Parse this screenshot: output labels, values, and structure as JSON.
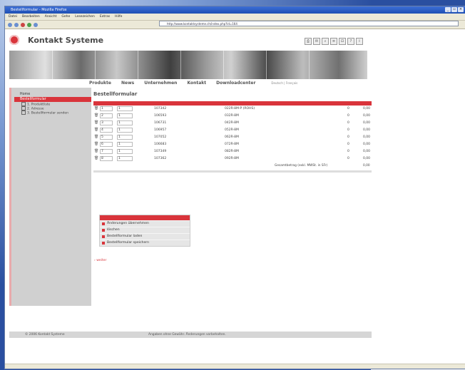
{
  "browser": {
    "title": "Bestellformular - Mozilla Firefox",
    "window_controls": [
      "_",
      "▫",
      "×"
    ],
    "menu": [
      "Datei",
      "Bearbeiten",
      "Ansicht",
      "Gehe",
      "Lesezeichen",
      "Extras",
      "Hilfe"
    ],
    "address": "http://www.kontaktsysteme.ch/index.php?id=164"
  },
  "site": {
    "logo_text": "Kontakt Systeme",
    "nav": [
      "Produkte",
      "News",
      "Unternehmen",
      "Kontakt",
      "Downloadcenter"
    ],
    "language": "Deutsch | Français"
  },
  "sidebar": {
    "items": [
      {
        "label": "Home"
      },
      {
        "label": "Bestellformular"
      }
    ],
    "sub_items": [
      "1. Produktliste",
      "2. Adresse",
      "3. Bestellformular senden"
    ]
  },
  "order": {
    "title": "Bestellformular",
    "rows": [
      {
        "pos": "1",
        "qty": "1",
        "art": "107342",
        "desc": "022R-8M-P (ROHS)",
        "unit": "0",
        "total": "0,00"
      },
      {
        "pos": "2",
        "qty": "1",
        "art": "106593",
        "desc": "032R-8M",
        "unit": "0",
        "total": "0,00"
      },
      {
        "pos": "3",
        "qty": "1",
        "art": "106731",
        "desc": "042R-8M",
        "unit": "0",
        "total": "0,00"
      },
      {
        "pos": "4",
        "qty": "1",
        "art": "106957",
        "desc": "052R-8M",
        "unit": "0",
        "total": "0,00"
      },
      {
        "pos": "5",
        "qty": "1",
        "art": "107052",
        "desc": "062R-8M",
        "unit": "0",
        "total": "0,00"
      },
      {
        "pos": "6",
        "qty": "1",
        "art": "106683",
        "desc": "072R-8M",
        "unit": "0",
        "total": "0,00"
      },
      {
        "pos": "7",
        "qty": "1",
        "art": "107349",
        "desc": "082R-8M",
        "unit": "0",
        "total": "0,00"
      },
      {
        "pos": "8",
        "qty": "1",
        "art": "107362",
        "desc": "092R-8M",
        "unit": "0",
        "total": "0,00"
      }
    ],
    "sum_label": "Gesamtbetrag (exkl. MWSt. in SFr)",
    "sum_value": "0,00"
  },
  "actions": {
    "items": [
      "Änderungen übernehmen",
      "löschen",
      "Bestellformular laden",
      "Bestellformular speichern"
    ],
    "next": "weiter"
  },
  "footer": {
    "copyright": "© 2006 Kontakt Systeme",
    "note": "Angaben ohne Gewähr. Änderungen vorbehalten."
  },
  "colors": {
    "accent": "#d9343b",
    "sidebar": "#d0d0d0"
  }
}
